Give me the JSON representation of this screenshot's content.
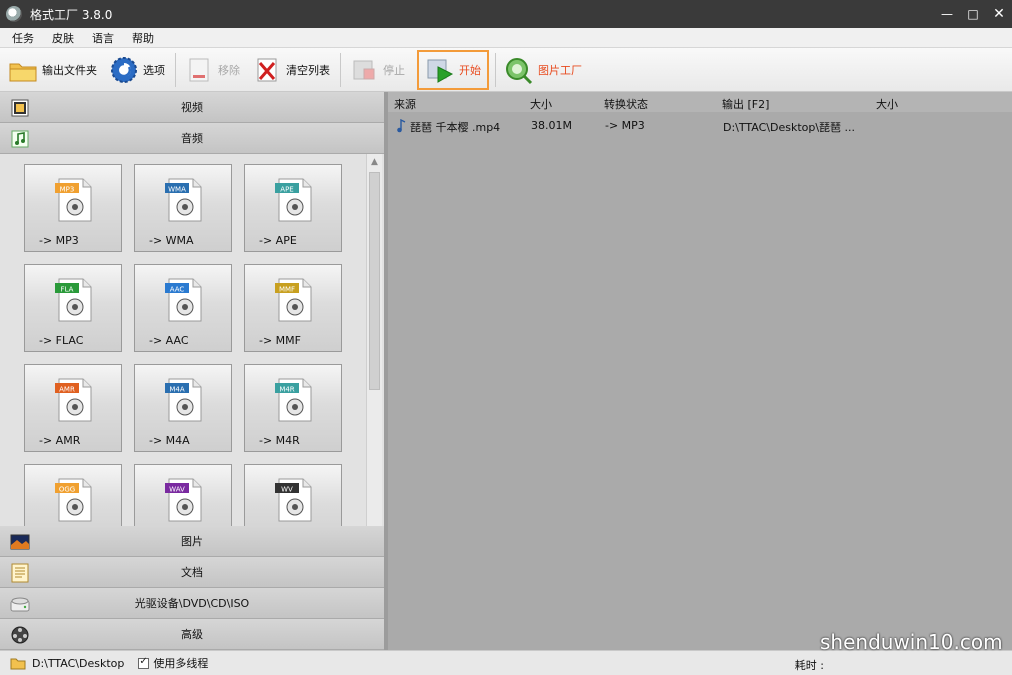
{
  "window": {
    "title": "格式工厂 3.8.0"
  },
  "menu": [
    "任务",
    "皮肤",
    "语言",
    "帮助"
  ],
  "toolbar": {
    "output_folder": "输出文件夹",
    "options": "选项",
    "remove": "移除",
    "clear_list": "清空列表",
    "stop": "停止",
    "start": "开始",
    "picture_factory": "图片工厂"
  },
  "categories_top": [
    "视频",
    "音频"
  ],
  "audio_formats": [
    {
      "tag": "MP3",
      "label": "-> MP3",
      "color": "#f0a030"
    },
    {
      "tag": "WMA",
      "label": "-> WMA",
      "color": "#2a6fb0"
    },
    {
      "tag": "APE",
      "label": "-> APE",
      "color": "#3aa0a0"
    },
    {
      "tag": "FLA",
      "label": "-> FLAC",
      "color": "#2a9a3a"
    },
    {
      "tag": "AAC",
      "label": "-> AAC",
      "color": "#2a7ad0"
    },
    {
      "tag": "MMF",
      "label": "-> MMF",
      "color": "#c8a020"
    },
    {
      "tag": "AMR",
      "label": "-> AMR",
      "color": "#e06020"
    },
    {
      "tag": "M4A",
      "label": "-> M4A",
      "color": "#2a6fb0"
    },
    {
      "tag": "M4R",
      "label": "-> M4R",
      "color": "#3aa0a0"
    },
    {
      "tag": "OGG",
      "label": "",
      "color": "#f0a030"
    },
    {
      "tag": "WAV",
      "label": "",
      "color": "#7a2aa0"
    },
    {
      "tag": "WV",
      "label": "",
      "color": "#333333"
    }
  ],
  "categories_bottom": [
    "图片",
    "文档",
    "光驱设备\\DVD\\CD\\ISO",
    "高级"
  ],
  "table": {
    "headers": [
      "来源",
      "大小",
      "转换状态",
      "输出 [F2]",
      "大小"
    ],
    "rows": [
      {
        "source": "琵琶 千本樱 .mp4",
        "size": "38.01M",
        "status": "-> MP3",
        "output": "D:\\TTAC\\Desktop\\琵琶 ...",
        "out_size": ""
      }
    ]
  },
  "status": {
    "path": "D:\\TTAC\\Desktop",
    "multithread": "使用多线程",
    "elapsed_label": "耗时 :"
  },
  "watermark": "shenduwin10.com"
}
